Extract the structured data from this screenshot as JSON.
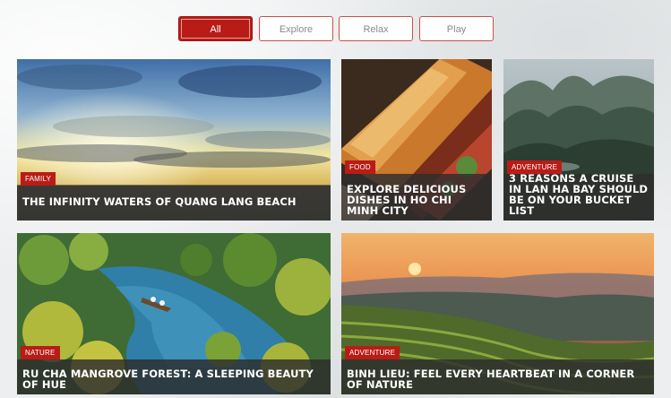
{
  "filters": {
    "all": "All",
    "explore": "Explore",
    "relax": "Relax",
    "play": "Play"
  },
  "colors": {
    "accent": "#b91c16",
    "filter_border": "#c9504a"
  },
  "cards": [
    {
      "category": "FAMILY",
      "title": "THE INFINITY WATERS OF QUANG LANG BEACH"
    },
    {
      "category": "FOOD",
      "title": "EXPLORE DELICIOUS DISHES IN HO CHI MINH CITY"
    },
    {
      "category": "ADVENTURE",
      "title": "3 REASONS A CRUISE IN LAN HA BAY SHOULD BE ON YOUR BUCKET LIST"
    },
    {
      "category": "NATURE",
      "title": "RU CHA MANGROVE FOREST: A SLEEPING BEAUTY OF HUE"
    },
    {
      "category": "ADVENTURE",
      "title": "BINH LIEU: FEEL EVERY HEARTBEAT IN A CORNER OF NATURE"
    }
  ]
}
